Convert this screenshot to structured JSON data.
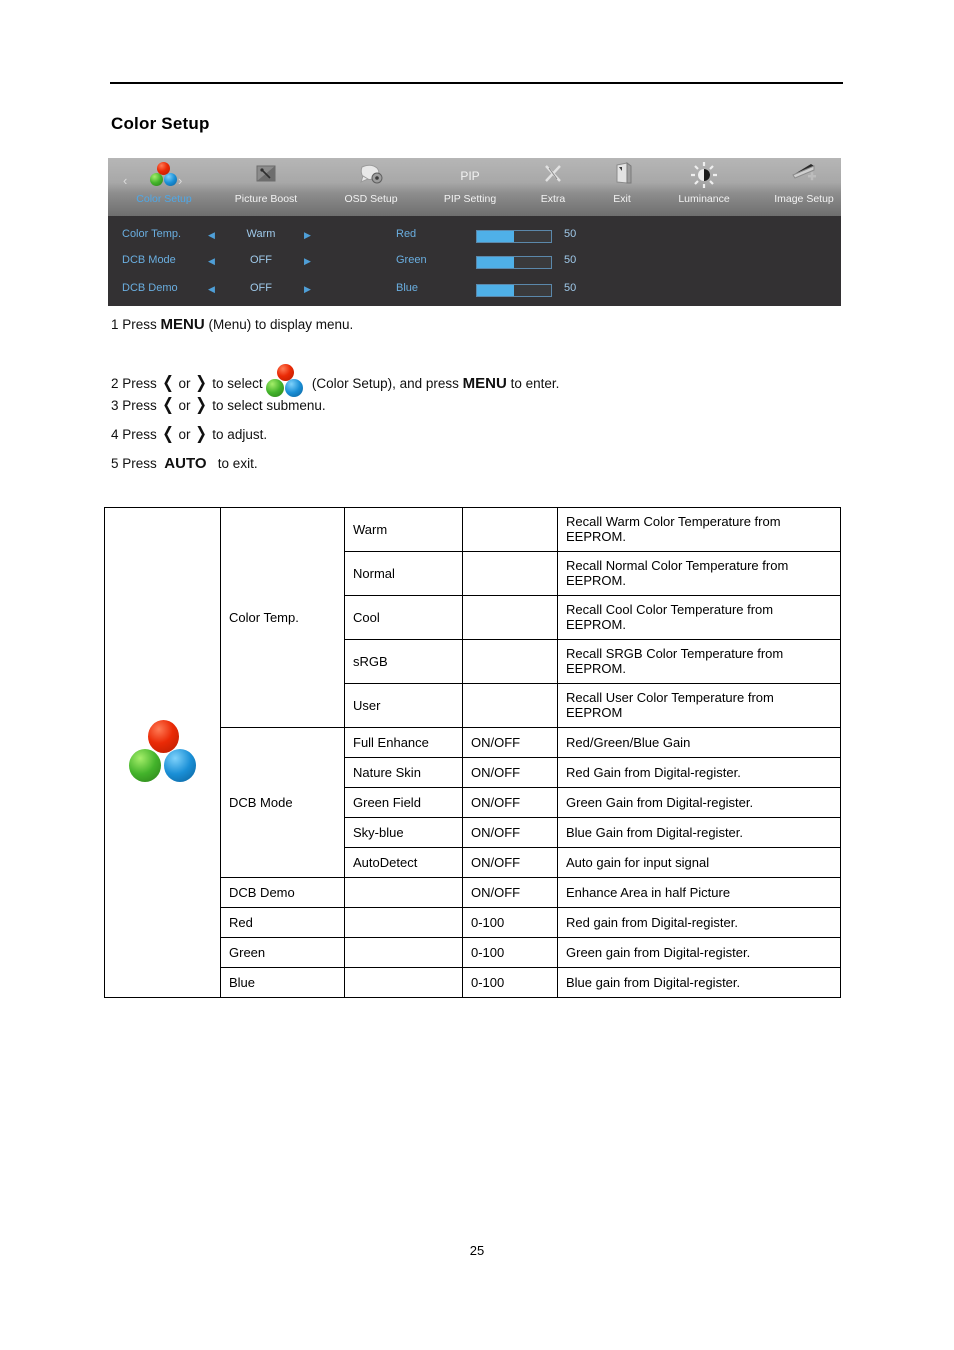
{
  "document": {
    "page_title": "Color Setup",
    "page_number": "25"
  },
  "osd": {
    "top_menu": [
      {
        "label": "Color Setup",
        "icon": "color-balls-icon",
        "active": true
      },
      {
        "label": "Picture Boost",
        "icon": "picture-boost-icon",
        "active": false
      },
      {
        "label": "OSD Setup",
        "icon": "osd-setup-icon",
        "active": false
      },
      {
        "label": "PIP Setting",
        "icon": "pip-icon",
        "active": false
      },
      {
        "label": "Extra",
        "icon": "scissors-icon",
        "active": false
      },
      {
        "label": "Exit",
        "icon": "exit-door-icon",
        "active": false
      },
      {
        "label": "Luminance",
        "icon": "brightness-sun-icon",
        "active": false
      },
      {
        "label": "Image Setup",
        "icon": "image-setup-icon",
        "active": false
      }
    ],
    "pip_icon_text": "PIP",
    "nav_left_arrow": "‹",
    "nav_right_arrow": "›",
    "arrow_left": "◀",
    "arrow_right": "▶",
    "left_rows": [
      {
        "label": "Color Temp.",
        "value": "Warm"
      },
      {
        "label": "DCB Mode",
        "value": "OFF"
      },
      {
        "label": "DCB Demo",
        "value": "OFF"
      }
    ],
    "right_rows": [
      {
        "label": "Red",
        "value": "50",
        "percent": 50
      },
      {
        "label": "Green",
        "value": "50",
        "percent": 50
      },
      {
        "label": "Blue",
        "value": "50",
        "percent": 50
      }
    ],
    "colors": {
      "panel_bg": "#333133",
      "label_blue": "#6aaee0",
      "slider_fill": "#4fb0e8",
      "active_label": "#4ea8e8"
    }
  },
  "steps": {
    "s1": {
      "num": "1 Press ",
      "key": "MENU",
      "rest": " (Menu) to display menu."
    },
    "s2": {
      "num": "2 Press ",
      "left": "❮",
      "or": " or ",
      "right": "❯",
      "mid": " to select ",
      "paren": "(Color Setup), and press ",
      "key": "MENU",
      "rest": " to enter."
    },
    "s3": {
      "num": "3 Press ",
      "left": "❮",
      "or": " or ",
      "right": "❯",
      "rest": " to select submenu."
    },
    "s4": {
      "num": "4 Press ",
      "left": "❮",
      "or": " or ",
      "right": "❯",
      "rest": " to adjust."
    },
    "s5": {
      "num": "5 Press ",
      "key": "AUTO",
      "rest": " to exit."
    }
  },
  "table": {
    "rows": [
      {
        "group": "Color Temp.",
        "sub": "Warm",
        "range": "",
        "desc": "Recall Warm Color Temperature from EEPROM."
      },
      {
        "group": "",
        "sub": "Normal",
        "range": "",
        "desc": "Recall Normal Color Temperature from EEPROM."
      },
      {
        "group": "",
        "sub": "Cool",
        "range": "",
        "desc": "Recall Cool Color Temperature from EEPROM."
      },
      {
        "group": "",
        "sub": "sRGB",
        "range": "",
        "desc": "Recall SRGB Color Temperature from EEPROM."
      },
      {
        "group": "",
        "sub": "User",
        "range": "",
        "desc": "Recall User Color Temperature from EEPROM"
      },
      {
        "group": "",
        "sub": "Full Enhance",
        "range": "ON/OFF",
        "desc": "Red/Green/Blue Gain"
      },
      {
        "group": "DCB Mode",
        "sub": "Nature Skin",
        "range": "ON/OFF",
        "desc": "Red Gain from Digital-register."
      },
      {
        "group": "",
        "sub": "Green Field",
        "range": "ON/OFF",
        "desc": "Green Gain from Digital-register."
      },
      {
        "group": "",
        "sub": "Sky-blue",
        "range": "ON/OFF",
        "desc": "Blue Gain from Digital-register."
      },
      {
        "group": "",
        "sub": "AutoDetect",
        "range": "ON/OFF",
        "desc": "Auto gain for input signal"
      },
      {
        "group": "DCB Demo",
        "sub": "",
        "range": "ON/OFF",
        "desc": "Enhance Area in half Picture"
      },
      {
        "group": "Red",
        "sub": "",
        "range": "0-100",
        "desc": "Red gain from Digital-register."
      },
      {
        "group": "Green",
        "sub": "",
        "range": "0-100",
        "desc": "Green gain from Digital-register."
      },
      {
        "group": "Blue",
        "sub": "",
        "range": "0-100",
        "desc": "Blue gain from Digital-register."
      }
    ]
  }
}
